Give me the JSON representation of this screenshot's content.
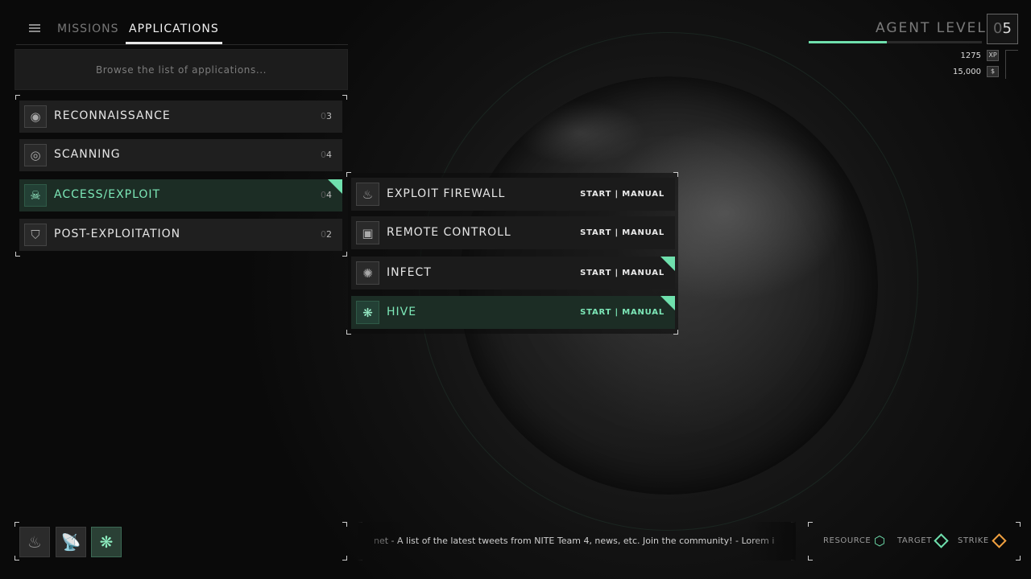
{
  "nav": {
    "menu_icon": "hamburger-icon",
    "tabs": [
      {
        "label": "MISSIONS",
        "active": false
      },
      {
        "label": "APPLICATIONS",
        "active": true
      }
    ]
  },
  "search": {
    "placeholder": "Browse the list of applications..."
  },
  "categories": [
    {
      "label": "RECONNAISSANCE",
      "count_prefix": "0",
      "count_suffix": "3",
      "icon": "eye-icon",
      "active": false
    },
    {
      "label": "SCANNING",
      "count_prefix": "0",
      "count_suffix": "4",
      "icon": "radar-icon",
      "active": false
    },
    {
      "label": "ACCESS/EXPLOIT",
      "count_prefix": "0",
      "count_suffix": "4",
      "icon": "skull-icon",
      "active": true
    },
    {
      "label": "POST-EXPLOITATION",
      "count_prefix": "0",
      "count_suffix": "2",
      "icon": "shield-icon",
      "active": false
    }
  ],
  "applications": [
    {
      "label": "EXPLOIT FIREWALL",
      "action": "START | MANUAL",
      "icon": "fire-icon",
      "active": false,
      "new": false
    },
    {
      "label": "REMOTE CONTROLL",
      "action": "START | MANUAL",
      "icon": "remote-icon",
      "active": false,
      "new": false
    },
    {
      "label": "INFECT",
      "action": "START | MANUAL",
      "icon": "bug-icon",
      "active": false,
      "new": true
    },
    {
      "label": "HIVE",
      "action": "START | MANUAL",
      "icon": "hive-icon",
      "active": true,
      "new": true
    }
  ],
  "agent": {
    "title": "AGENT LEVEL",
    "level_prefix": "0",
    "level_suffix": "5",
    "xp_value": "1275",
    "xp_unit": "XP",
    "money_value": "15,000",
    "money_unit": "$",
    "xp_progress": 0.45,
    "accent": "#6fe0ad"
  },
  "quickbar": [
    {
      "icon": "fire-icon",
      "active": false
    },
    {
      "icon": "satellite-dish-icon",
      "active": false
    },
    {
      "icon": "hive-icon",
      "active": true
    }
  ],
  "ticker": {
    "text": "net - A list of the latest tweets from NITE Team 4, news, etc. Join the community! - Lorem i"
  },
  "legend": [
    {
      "label": "RESOURCE",
      "shape": "hexagon",
      "color": "#6fe0ad"
    },
    {
      "label": "TARGET",
      "shape": "diamond",
      "color": "#6fe0ad"
    },
    {
      "label": "STRIKE",
      "shape": "diamond",
      "color": "#f0a040"
    }
  ]
}
